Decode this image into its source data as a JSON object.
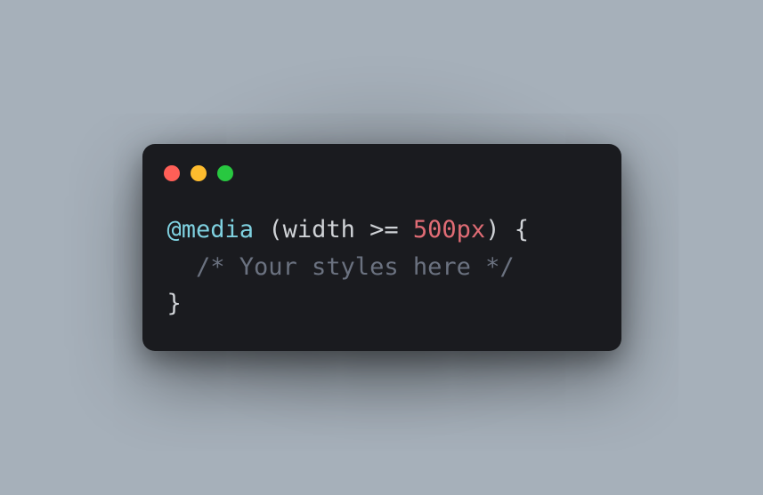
{
  "window": {
    "traffic_lights": {
      "close": "close",
      "minimize": "minimize",
      "zoom": "zoom"
    }
  },
  "code": {
    "line1": {
      "keyword": "@media",
      "space1": " ",
      "lparen": "(",
      "ident": "width",
      "space2": " ",
      "op": ">=",
      "space3": " ",
      "number": "500px",
      "rparen": ")",
      "space4": " ",
      "lbrace": "{"
    },
    "line2": {
      "comment": "/* Your styles here */"
    },
    "line3": {
      "rbrace": "}"
    }
  }
}
